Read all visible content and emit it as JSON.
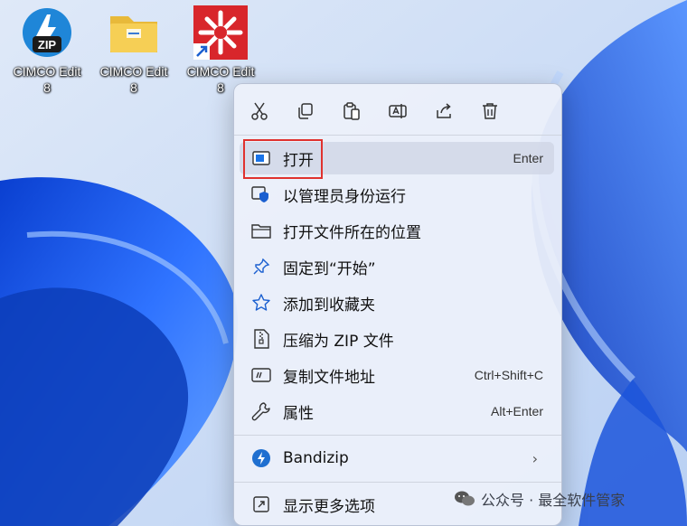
{
  "desktop": {
    "icons": [
      {
        "line1": "CIMCO Edit",
        "line2": "8"
      },
      {
        "line1": "CIMCO Edit",
        "line2": "8"
      },
      {
        "line1": "CIMCO Edit",
        "line2": "8"
      }
    ],
    "zip_badge": "ZIP"
  },
  "menu": {
    "quick_actions": [
      "cut-icon",
      "copy-icon",
      "paste-icon",
      "rename-icon",
      "share-icon",
      "delete-icon"
    ],
    "items": [
      {
        "label": "打开",
        "shortcut": "Enter"
      },
      {
        "label": "以管理员身份运行",
        "shortcut": ""
      },
      {
        "label": "打开文件所在的位置",
        "shortcut": ""
      },
      {
        "label": "固定到“开始”",
        "shortcut": ""
      },
      {
        "label": "添加到收藏夹",
        "shortcut": ""
      },
      {
        "label": "压缩为 ZIP 文件",
        "shortcut": ""
      },
      {
        "label": "复制文件地址",
        "shortcut": "Ctrl+Shift+C"
      },
      {
        "label": "属性",
        "shortcut": "Alt+Enter"
      }
    ],
    "bandizip": {
      "label": "Bandizip",
      "chevron": "›"
    },
    "more": {
      "label": "显示更多选项"
    }
  },
  "watermark": {
    "text": "公众号 · 最全软件管家"
  },
  "colors": {
    "accent": "#1a73e8",
    "highlight": "#e0322f",
    "wallpaper": "#1e5de0"
  }
}
